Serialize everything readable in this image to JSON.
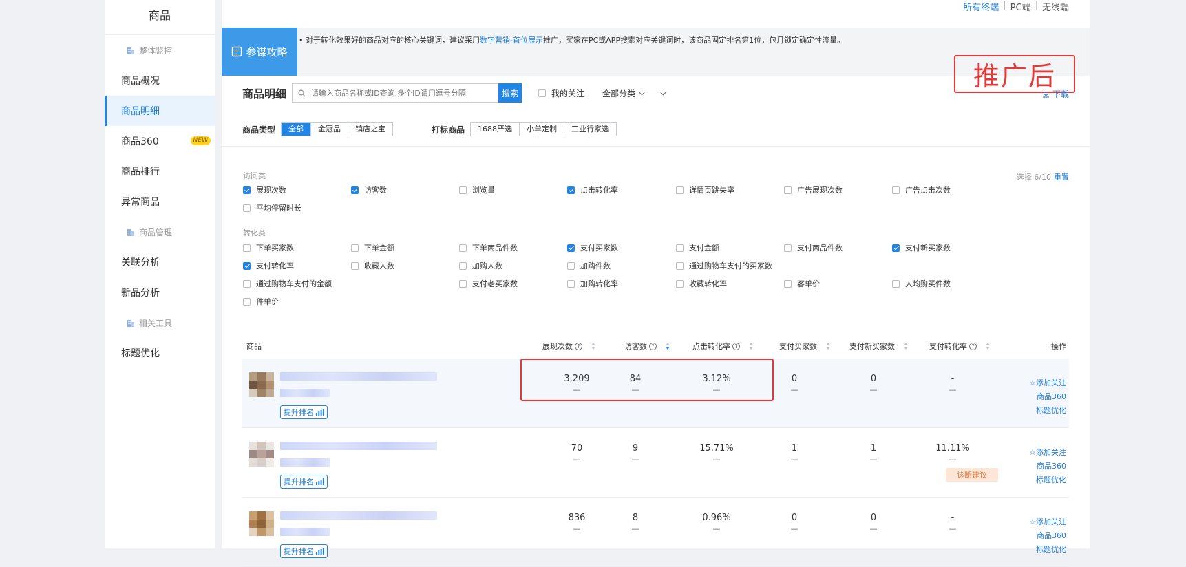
{
  "sidebar": {
    "title": "商品",
    "group_monitor": "整体监控",
    "items_monitor": [
      {
        "label": "商品概况"
      },
      {
        "label": "商品明细"
      },
      {
        "label": "商品360",
        "badge": "NEW"
      },
      {
        "label": "商品排行"
      },
      {
        "label": "异常商品"
      }
    ],
    "group_manage": "商品管理",
    "items_manage": [
      {
        "label": "关联分析"
      },
      {
        "label": "新品分析"
      }
    ],
    "group_tools": "相关工具",
    "items_tools": [
      {
        "label": "标题优化"
      }
    ]
  },
  "terminal": {
    "all": "所有终端",
    "pc": "PC端",
    "wireless": "无线端"
  },
  "tip": {
    "button": "参谋攻略",
    "text_before": "对于转化效果好的商品对应的核心关键词，建议采用",
    "link": "数字营销-首位展示",
    "text_after": "推广，买家在PC或APP搜索对应关键词时，该商品固定排名第1位，包月锁定确定性流量。"
  },
  "stamp": "推广后",
  "detail": {
    "title": "商品明细",
    "search_placeholder": "请输入商品名称或ID查询,多个ID请用逗号分隔",
    "search_button": "搜索",
    "follow": "我的关注",
    "category": "全部分类",
    "download": "下载"
  },
  "filters": {
    "type_label": "商品类型",
    "types": [
      "全部",
      "金冠品",
      "镇店之宝"
    ],
    "mark_label": "打标商品",
    "marks": [
      "1688严选",
      "小单定制",
      "工业行家选"
    ]
  },
  "metrics": {
    "visit_label": "访问类",
    "convert_label": "转化类",
    "select_count": "选择 6/10",
    "reset": "重置",
    "visit": [
      {
        "label": "展现次数",
        "checked": true
      },
      {
        "label": "访客数",
        "checked": true
      },
      {
        "label": "浏览量",
        "checked": false
      },
      {
        "label": "点击转化率",
        "checked": true
      },
      {
        "label": "详情页跳失率",
        "checked": false
      },
      {
        "label": "广告展现次数",
        "checked": false
      },
      {
        "label": "广告点击次数",
        "checked": false
      },
      {
        "label": "平均停留时长",
        "checked": false
      }
    ],
    "convert": [
      {
        "label": "下单买家数",
        "checked": false
      },
      {
        "label": "下单金额",
        "checked": false
      },
      {
        "label": "下单商品件数",
        "checked": false
      },
      {
        "label": "支付买家数",
        "checked": true
      },
      {
        "label": "支付金额",
        "checked": false
      },
      {
        "label": "支付商品件数",
        "checked": false
      },
      {
        "label": "支付新买家数",
        "checked": true
      },
      {
        "label": "支付转化率",
        "checked": true
      },
      {
        "label": "收藏人数",
        "checked": false
      },
      {
        "label": "加购人数",
        "checked": false
      },
      {
        "label": "加购件数",
        "checked": false
      },
      {
        "label": "通过购物车支付的买家数",
        "checked": false
      },
      {
        "label": "通过购物车支付的金额",
        "checked": false
      },
      {
        "label": "支付老买家数",
        "checked": false
      },
      {
        "label": "加购转化率",
        "checked": false
      },
      {
        "label": "收藏转化率",
        "checked": false
      },
      {
        "label": "客单价",
        "checked": false
      },
      {
        "label": "人均购买件数",
        "checked": false
      },
      {
        "label": "件单价",
        "checked": false
      }
    ]
  },
  "table": {
    "headers": {
      "product": "商品",
      "impressions": "展现次数",
      "visitors": "访客数",
      "ctr": "点击转化率",
      "buyers": "支付买家数",
      "new_buyers": "支付新买家数",
      "pay_rate": "支付转化率",
      "ops": "操作"
    },
    "rank_button": "提升排名",
    "dash": "—",
    "ops": {
      "follow": "☆添加关注",
      "p360": "商品360",
      "title_opt": "标题优化"
    },
    "diag_button": "诊断建议",
    "rows": [
      {
        "impressions": "3,209",
        "visitors": "84",
        "ctr": "3.12%",
        "buyers": "0",
        "new_buyers": "0",
        "pay_rate": "-"
      },
      {
        "impressions": "70",
        "visitors": "9",
        "ctr": "15.71%",
        "buyers": "1",
        "new_buyers": "1",
        "pay_rate": "11.11%"
      },
      {
        "impressions": "836",
        "visitors": "8",
        "ctr": "0.96%",
        "buyers": "0",
        "new_buyers": "0",
        "pay_rate": "-"
      }
    ]
  }
}
